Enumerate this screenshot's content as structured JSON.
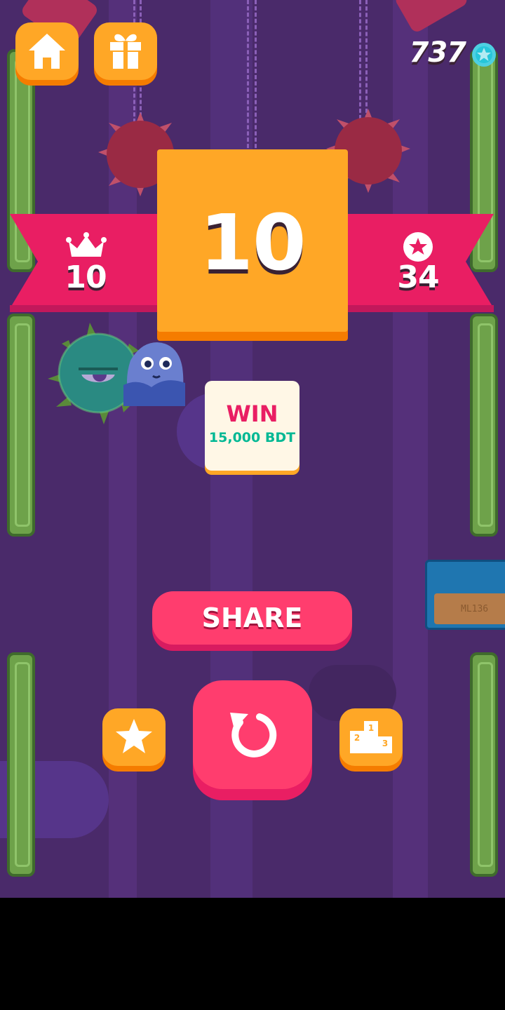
{
  "header": {
    "coins": "737"
  },
  "score_panel": {
    "score": "10",
    "best_score": "10",
    "stars": "34"
  },
  "promo": {
    "title": "WIN",
    "prize": "15,000 BDT"
  },
  "share_button": {
    "label": "SHARE"
  },
  "background": {
    "sign_text": "ML136"
  },
  "colors": {
    "background": "#4a2a6a",
    "orange": "#ffa726",
    "pink": "#ff3d6e",
    "ribbon": "#e91e63",
    "coin": "#4dd0e1",
    "promo_text": "#e91e63",
    "promo_prize": "#00b894"
  }
}
